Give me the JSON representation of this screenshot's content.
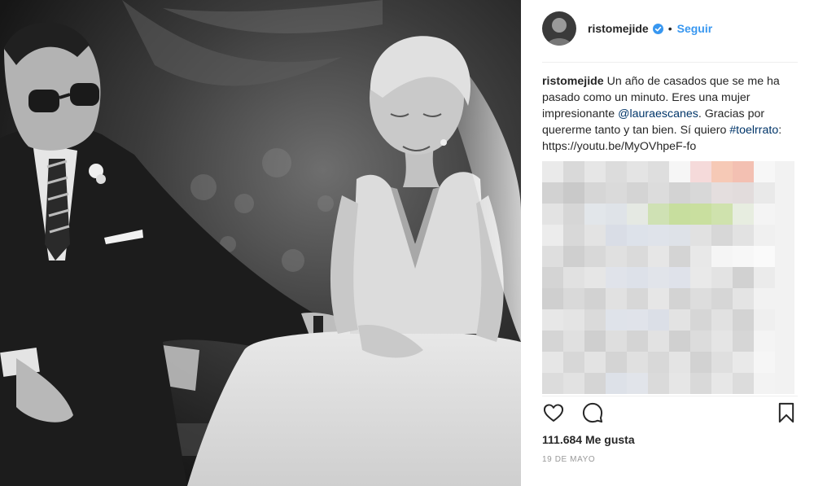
{
  "post": {
    "username": "ristomejide",
    "follow_label": "Seguir",
    "separator": "•",
    "caption_user": "ristomejide",
    "caption_text_1": "Un año de casados que se me ha pasado como un minuto. Eres una mujer impresionante ",
    "caption_mention": "@lauraescanes",
    "caption_text_2": ". Gracias por quererme tanto y tan bien. Sí quiero ",
    "caption_hashtag": "#toelrrato",
    "caption_text_3": ": https://youtu.be/MyOVhpeF-fo",
    "likes": "111.684 Me gusta",
    "date": "19 de mayo"
  },
  "icons": {
    "verified": "verified-badge-icon",
    "like": "heart-icon",
    "comment": "comment-bubble-icon",
    "save": "bookmark-icon"
  },
  "colors": {
    "link": "#003569",
    "follow": "#3897f0",
    "verified": "#3897f0"
  }
}
